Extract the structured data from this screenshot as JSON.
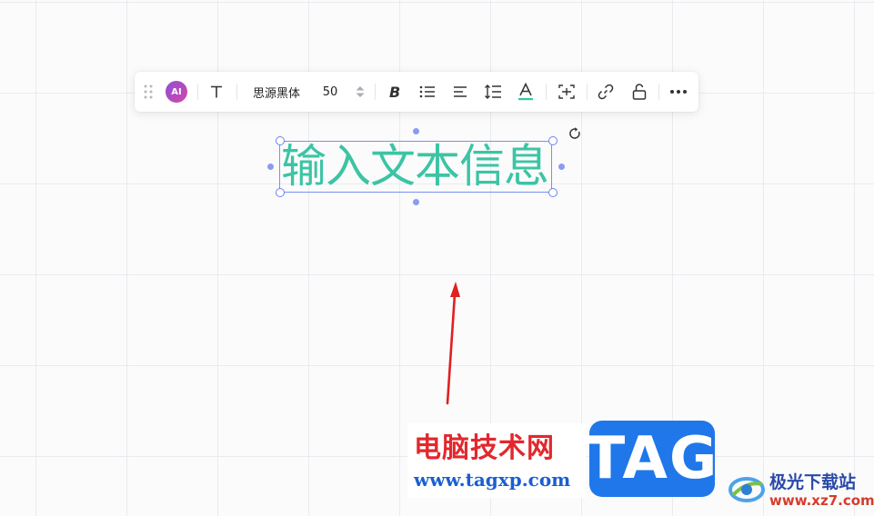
{
  "toolbar": {
    "ai_label": "AI",
    "font_family": "思源黑体",
    "font_size": "50",
    "icons": [
      "drag-handle-icon",
      "ai-icon",
      "text-type-icon",
      "font-size-stepper-icon",
      "bold-icon",
      "bullet-list-icon",
      "align-left-icon",
      "line-height-icon",
      "text-color-icon",
      "text-box-fit-icon",
      "link-icon",
      "unlock-icon",
      "more-icon"
    ],
    "text_color_underline": "#3cc4a4"
  },
  "canvas": {
    "text_content": "输入文本信息",
    "text_color": "#3cc4a4",
    "selection_color": "#7c8ff0",
    "annotation_arrow_color": "#e02020"
  },
  "watermark": {
    "site_name": "电脑技术网",
    "site_url": "www.tagxp.com",
    "tag_label": "TAG",
    "secondary_name": "极光下载站",
    "secondary_url": "www.xz7.com"
  }
}
